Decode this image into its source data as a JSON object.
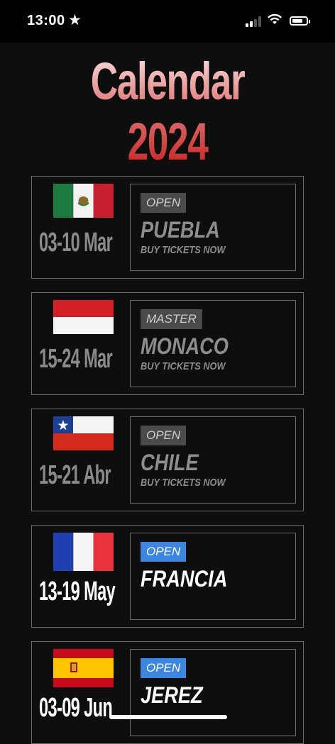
{
  "status_bar": {
    "time": "13:00",
    "star": "★"
  },
  "title": "Calendar 2024",
  "events": [
    {
      "flag": "mexico-flag",
      "dates": "03-10 Mar",
      "badge": "OPEN",
      "city": "PUEBLA",
      "tickets": "BUY TICKETS NOW"
    },
    {
      "flag": "monaco-flag",
      "dates": "15-24 Mar",
      "badge": "MASTER",
      "city": "MONACO",
      "tickets": "BUY TICKETS NOW"
    },
    {
      "flag": "chile-flag",
      "dates": "15-21 Abr",
      "badge": "OPEN",
      "city": "CHILE",
      "tickets": "BUY TICKETS NOW"
    },
    {
      "flag": "france-flag",
      "dates": "13-19 May",
      "badge": "OPEN",
      "city": "FRANCIA"
    },
    {
      "flag": "spain-flag",
      "dates": "03-09 Jun",
      "badge": "OPEN",
      "city": "JEREZ"
    }
  ],
  "colors": {
    "accent_blue": "#3d86e0",
    "badge_gray": "#4a4a4a",
    "title_red": "#c52020"
  }
}
